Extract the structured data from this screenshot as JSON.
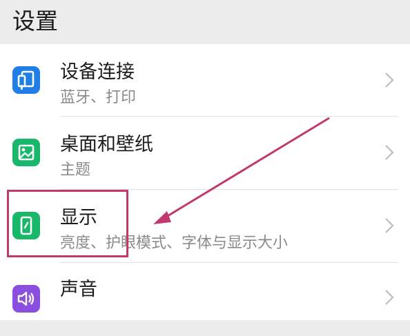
{
  "header": {
    "title": "设置"
  },
  "settings": {
    "items": [
      {
        "label": "设备连接",
        "subtitle": "蓝牙、打印",
        "icon": "device-connection-icon",
        "icon_color": "#1f7fe6"
      },
      {
        "label": "桌面和壁纸",
        "subtitle": "主题",
        "icon": "wallpaper-icon",
        "icon_color": "#18b76a"
      },
      {
        "label": "显示",
        "subtitle": "亮度、护眼模式、字体与显示大小",
        "icon": "display-icon",
        "icon_color": "#18b76a"
      },
      {
        "label": "声音",
        "subtitle": "",
        "icon": "sound-icon",
        "icon_color": "#8a4ee0"
      }
    ]
  },
  "annotation": {
    "color": "#c2386e"
  }
}
